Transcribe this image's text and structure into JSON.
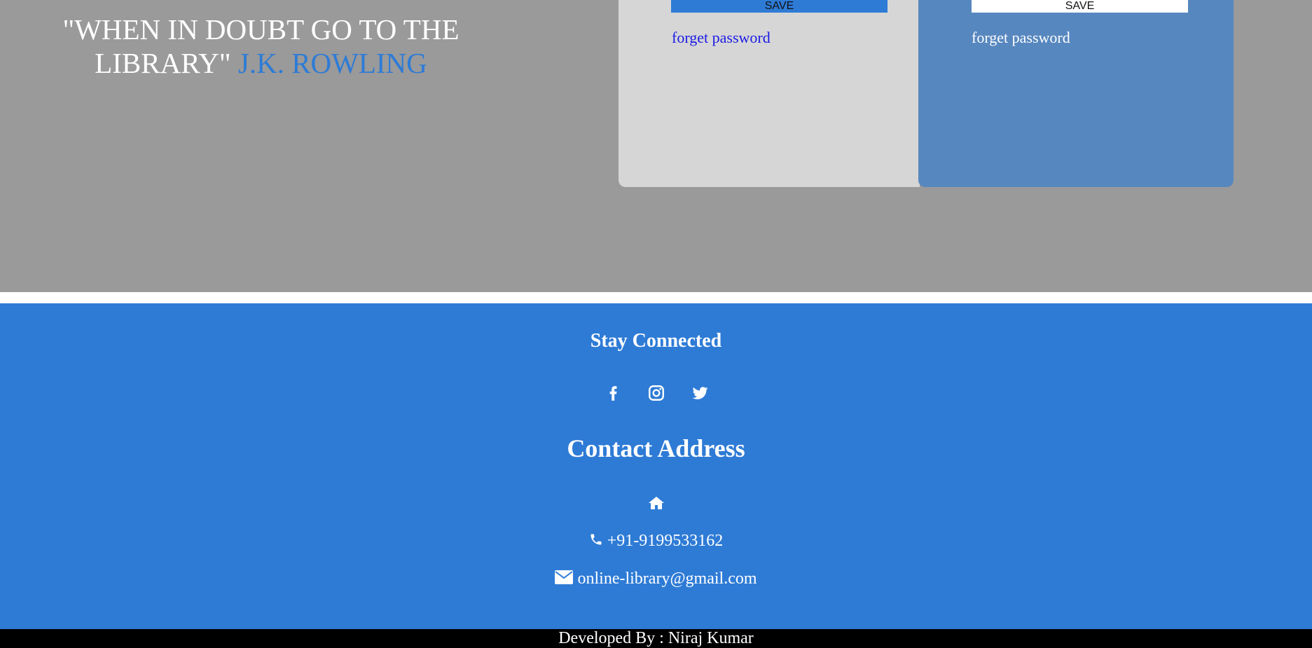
{
  "hero": {
    "quote": "\"WHEN IN DOUBT GO TO THE LIBRARY\"",
    "author": "J.K. ROWLING"
  },
  "login_cards": [
    {
      "button_label": "SAVE",
      "forgot_link": "forget password"
    },
    {
      "button_label": "SAVE",
      "forgot_link": "forget password"
    }
  ],
  "footer": {
    "stay_connected": "Stay Connected",
    "social_icons": [
      "facebook-icon",
      "instagram-icon",
      "twitter-icon"
    ],
    "contact_title": "Contact Address",
    "home_icon": "home-icon",
    "phone": "+91-9199533162",
    "email": "online-library@gmail.com",
    "developer": "Developed By : Niraj Kumar"
  },
  "colors": {
    "hero_bg": "#9a9a9a",
    "accent_blue": "#2e7bd6",
    "card_light": "#d6d6d6",
    "card_blue": "#5787bf",
    "footer_bg": "#2e7bd6",
    "dev_bar_bg": "#000000"
  }
}
